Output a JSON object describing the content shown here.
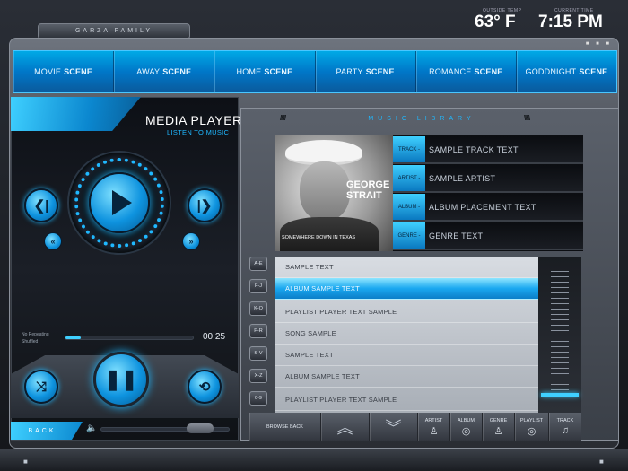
{
  "header": {
    "family": "GARZA FAMILY",
    "outside_temp_label": "OUTSIDE TEMP",
    "outside_temp": "63° F",
    "current_time_label": "CURRENT TIME",
    "current_time": "7:15 PM"
  },
  "scenes": [
    {
      "word1": "MOVIE",
      "word2": "SCENE"
    },
    {
      "word1": "AWAY",
      "word2": "SCENE"
    },
    {
      "word1": "HOME",
      "word2": "SCENE"
    },
    {
      "word1": "PARTY",
      "word2": "SCENE"
    },
    {
      "word1": "ROMANCE",
      "word2": "SCENE"
    },
    {
      "word1": "GODDNIGHT",
      "word2": "SCENE"
    }
  ],
  "media_player": {
    "title": "MEDIA PLAYER",
    "subtitle": "LISTEN TO MUSIC",
    "repeat_status": "No Repeating",
    "shuffle_status": "Shuffled",
    "time_elapsed": "00:25",
    "progress_fraction": 0.12,
    "back_label": "BACK"
  },
  "library": {
    "title": "MUSIC LIBRARY",
    "album_art": {
      "artist_line1": "GEORGE",
      "artist_line2": "STRAIT",
      "album_name": "SOMEWHERE DOWN IN TEXAS"
    },
    "meta": [
      {
        "tag": "TRACK -",
        "value": "SAMPLE TRACK TEXT"
      },
      {
        "tag": "ARTIST -",
        "value": "SAMPLE ARTIST"
      },
      {
        "tag": "ALBUM -",
        "value": "ALBUM PLACEMENT TEXT"
      },
      {
        "tag": "GENRE -",
        "value": "GENRE TEXT"
      }
    ],
    "letter_buttons": [
      "A-E",
      "F-J",
      "K-O",
      "P-R",
      "S-V",
      "X-Z",
      "0-9"
    ],
    "tracks": [
      "SAMPLE TEXT",
      "ALBUM SAMPLE TEXT",
      "PLAYLIST PLAYER TEXT SAMPLE",
      "SONG SAMPLE",
      "SAMPLE TEXT",
      "ALBUM SAMPLE TEXT",
      "PLAYLIST PLAYER TEXT SAMPLE"
    ],
    "active_track_index": 1,
    "toolbar": {
      "browse_back": "BROWSE BACK",
      "artist": "ARTIST",
      "album": "ALBUM",
      "genre": "GENRE",
      "playlist": "PLAYLIST",
      "track": "TRACK"
    }
  },
  "colors": {
    "accent": "#1fb8ff",
    "scene_bar": "#0077c8",
    "active_row": "#1aa8f0"
  }
}
